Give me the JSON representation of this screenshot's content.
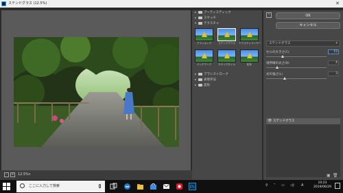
{
  "window": {
    "title": "ステンドグラス (12.5%)",
    "close_glyph": "✕"
  },
  "preview": {
    "zoom": "12.5%",
    "minus_label": "-",
    "plus_label": "+",
    "zoom_dropdown": "▾"
  },
  "gallery": {
    "categories": [
      {
        "label": "アーティスティック",
        "expanded": false
      },
      {
        "label": "スケッチ",
        "expanded": false
      },
      {
        "label": "テクスチャ",
        "expanded": true
      },
      {
        "label": "ブラシストローク",
        "expanded": false
      },
      {
        "label": "表現手法",
        "expanded": false
      },
      {
        "label": "変形",
        "expanded": false
      }
    ],
    "thumbnails": [
      {
        "label": "クラッキング",
        "selected": false
      },
      {
        "label": "ステンドグラス",
        "selected": true
      },
      {
        "label": "テクスチャライザー",
        "selected": false
      },
      {
        "label": "パッチワーク",
        "selected": false
      },
      {
        "label": "モザイクタイル",
        "selected": false
      },
      {
        "label": "粒状",
        "selected": false
      }
    ]
  },
  "settings": {
    "ok_label": "OK",
    "cancel_label": "キャンセル",
    "filter_select": "ステンドグラス",
    "params": [
      {
        "label": "セルの大きさ(C)",
        "value": "15",
        "active": true,
        "level": 0.27
      },
      {
        "label": "境界線の太さ(B)",
        "value": "4",
        "active": false,
        "level": 0.18
      },
      {
        "label": "光の強さ(L)",
        "value": "3",
        "active": false,
        "level": 0.3
      }
    ]
  },
  "layers": {
    "items": [
      {
        "label": "ステンドグラス",
        "visible": true
      }
    ]
  },
  "taskbar": {
    "search_placeholder": "ここに入力して検索",
    "clock_time": "10:23",
    "clock_date": "2019/06/29",
    "ime": "A",
    "accent_colors": {
      "edge": "#1e7fd8",
      "files": "#f2c13b",
      "store": "#3a8ee6",
      "mail": "#f2f2f2",
      "ps": "#31a8ff"
    }
  }
}
